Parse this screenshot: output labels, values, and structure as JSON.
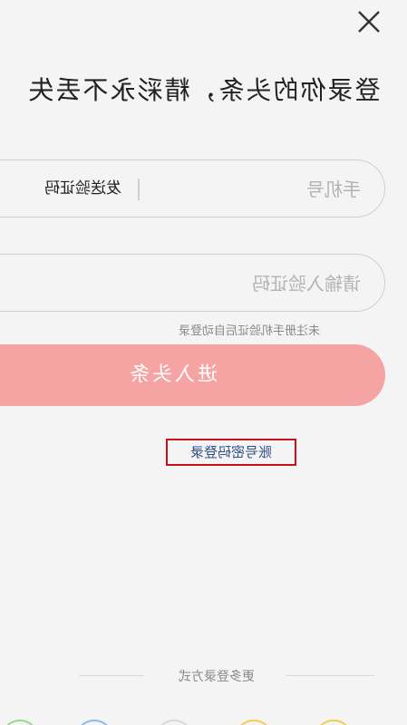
{
  "header": {
    "close_icon": "close-icon",
    "title": "登录你的头条，精彩永不丢失"
  },
  "form": {
    "phone_placeholder": "手机号",
    "send_code_label": "发送验证码",
    "code_placeholder": "请输入验证码",
    "hint": "未注册手机验证后自动登录",
    "submit_label": "进入头条",
    "submit_color": "#f5a3a3"
  },
  "links": {
    "password_login": "账号密码登录",
    "highlight_color": "#c8101c"
  },
  "footer": {
    "more_login": "更多登录方式",
    "icons": [
      "login-option-icon-1",
      "login-option-icon-2",
      "login-option-icon-3",
      "login-option-icon-4",
      "login-option-icon-5"
    ]
  }
}
